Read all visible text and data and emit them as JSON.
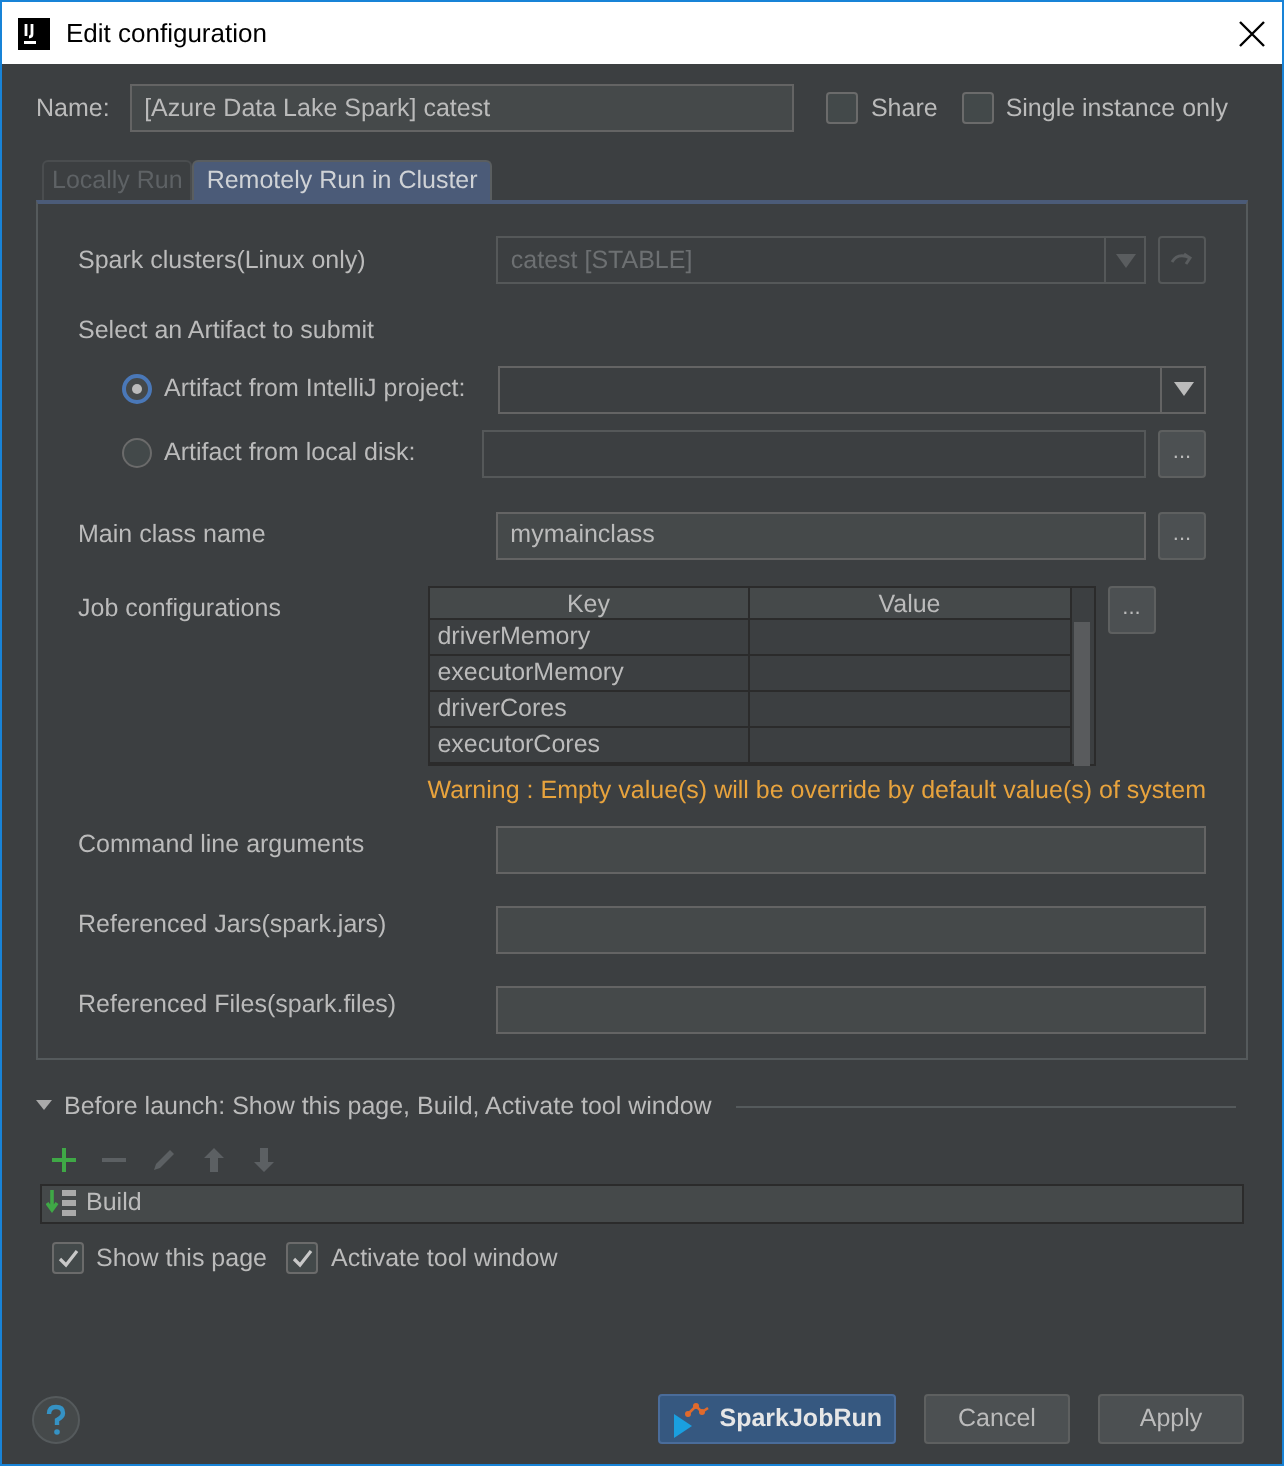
{
  "window": {
    "title": "Edit configuration"
  },
  "name": {
    "label": "Name:",
    "value": "[Azure Data Lake Spark] catest"
  },
  "options": [
    {
      "label": "Share",
      "checked": false
    },
    {
      "label": "Single instance only",
      "checked": false
    }
  ],
  "tabs": [
    {
      "label": "Locally Run",
      "selected": false
    },
    {
      "label": "Remotely Run in Cluster",
      "selected": true
    }
  ],
  "spark_clusters": {
    "label": "Spark clusters(Linux only)",
    "value": "catest [STABLE]",
    "disabled": true
  },
  "artifact": {
    "label": "Select an Artifact to submit",
    "options": [
      {
        "label": "Artifact from IntelliJ project:",
        "selected": true,
        "kind": "dropdown"
      },
      {
        "label": "Artifact from local disk:",
        "selected": false,
        "kind": "browse"
      }
    ]
  },
  "main_class": {
    "label": "Main class name",
    "value": "mymainclass",
    "browse": "..."
  },
  "job_configurations": {
    "label": "Job configurations",
    "columns": [
      "Key",
      "Value"
    ],
    "rows": [
      {
        "key": "driverMemory"
      },
      {
        "key": "executorMemory"
      },
      {
        "key": "driverCores"
      },
      {
        "key": "executorCores"
      }
    ],
    "browse": "...",
    "warning": "Warning : Empty value(s) will be override by default value(s) of system"
  },
  "fields": [
    {
      "label": "Command line arguments"
    },
    {
      "label": "Referenced Jars(spark.jars)"
    },
    {
      "label": "Referenced Files(spark.files)"
    }
  ],
  "before_launch": {
    "title": "Before launch: Show this page, Build, Activate tool window",
    "expanded": true,
    "tools": [
      {
        "kind": "add",
        "disabled": false
      },
      {
        "kind": "remove",
        "disabled": true
      },
      {
        "kind": "edit",
        "disabled": true
      },
      {
        "kind": "up",
        "disabled": true
      },
      {
        "kind": "down",
        "disabled": true
      }
    ],
    "tasks": [
      {
        "label": "Build"
      }
    ],
    "options": [
      {
        "label": "Show this page",
        "checked": true
      },
      {
        "label": "Activate tool window",
        "checked": true
      }
    ]
  },
  "buttons": [
    {
      "label": "SparkJobRun",
      "kind": "primary"
    },
    {
      "label": "Cancel",
      "kind": "normal"
    },
    {
      "label": "Apply",
      "kind": "normal"
    }
  ]
}
